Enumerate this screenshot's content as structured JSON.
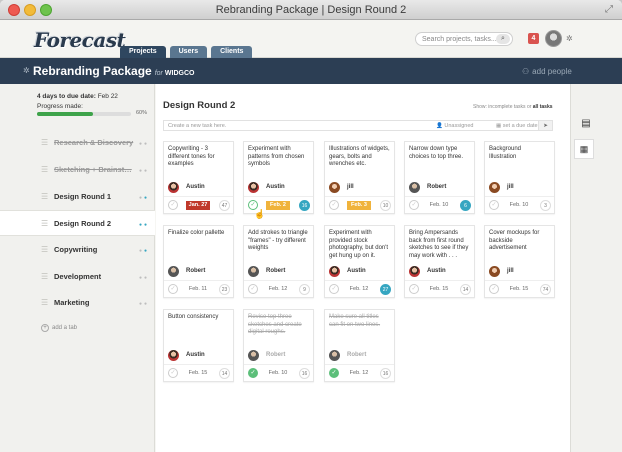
{
  "window": {
    "title": "Rebranding Package | Design Round 2"
  },
  "header": {
    "logo": "Forecast",
    "tabs": [
      {
        "label": "Projects"
      },
      {
        "label": "Users"
      },
      {
        "label": "Clients"
      }
    ],
    "search_placeholder": "Search projects, tasks...",
    "notifications": "4"
  },
  "project": {
    "name": "Rebranding Package",
    "for": "for",
    "client": "WIDGCO",
    "add_people": "add people"
  },
  "sidebar": {
    "due_prefix": "4 days to due date:",
    "due_date": "Feb 22",
    "progress_label": "Progress made:",
    "progress_value": 0.6,
    "progress_text": "60%",
    "items": [
      {
        "label": "Research & Discovery",
        "done": true
      },
      {
        "label": "Sketching + Brainst…",
        "done": true
      },
      {
        "label": "Design Round 1",
        "done": false
      },
      {
        "label": "Design Round 2",
        "done": false,
        "active": true
      },
      {
        "label": "Copywriting",
        "done": false
      },
      {
        "label": "Development",
        "done": false
      },
      {
        "label": "Marketing",
        "done": false
      }
    ],
    "add_tab": "add a tab"
  },
  "main": {
    "title": "Design Round 2",
    "show_prefix": "Show:",
    "show_incomplete": "incomplete tasks",
    "show_or": "or",
    "show_all": "all tasks",
    "new_task_placeholder": "Create a new task here.",
    "unassigned": "Unassigned",
    "set_due_date": "set a due date",
    "cards": [
      {
        "title": "Copywriting - 3 different tones for examples",
        "person": "Austin",
        "date": "Jan. 27",
        "count": "47"
      },
      {
        "title": "Experiment with patterns from chosen symbols",
        "person": "Austin",
        "date": "Feb. 2",
        "count": "16"
      },
      {
        "title": "Illustrations of widgets, gears, bolts and wrenches etc.",
        "person": "Jill",
        "date": "Feb. 3",
        "count": "10"
      },
      {
        "title": "Narrow down type choices to top three.",
        "person": "Robert",
        "date": "Feb. 10",
        "count": "6"
      },
      {
        "title": "Background Illustration",
        "person": "Jill",
        "date": "Feb. 10",
        "count": "3"
      },
      {
        "title": "Finalize color pallette",
        "person": "Robert",
        "date": "Feb. 11",
        "count": "23"
      },
      {
        "title": "Add strokes to triangle \"frames\" - try different weights",
        "person": "Robert",
        "date": "Feb. 12",
        "count": "9"
      },
      {
        "title": "Experiment with provided stock photography, but don't get hung up on it.",
        "person": "Austin",
        "date": "Feb. 12",
        "count": "27"
      },
      {
        "title": "Bring Ampersands back from first round sketches to see if they may work with . . .",
        "person": "Austin",
        "date": "Feb. 15",
        "count": "14"
      },
      {
        "title": "Cover mockups for backside advertisement",
        "person": "Jill",
        "date": "Feb. 15",
        "count": "74"
      },
      {
        "title": "Button consistency",
        "person": "Austin",
        "date": "Feb. 15",
        "count": "14"
      },
      {
        "title": "Revise top three sketches and create digital roughs.",
        "person": "Robert",
        "date": "Feb. 10",
        "count": "16"
      },
      {
        "title": "Make sure all titles can fit on two lines.",
        "person": "Robert",
        "date": "Feb. 12",
        "count": "16"
      }
    ]
  }
}
